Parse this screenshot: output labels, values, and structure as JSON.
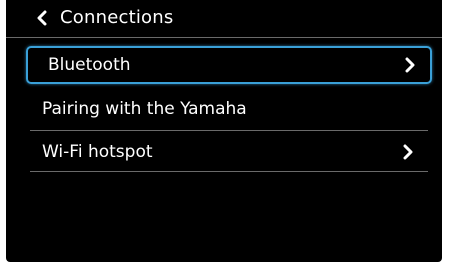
{
  "header": {
    "title": "Connections",
    "back_icon": "chevron-left-icon"
  },
  "menu": {
    "items": [
      {
        "label": "Bluetooth",
        "has_chevron": true,
        "selected": true
      },
      {
        "label": "Pairing with the Yamaha",
        "has_chevron": false,
        "selected": false
      },
      {
        "label": "Wi-Fi hotspot",
        "has_chevron": true,
        "selected": false
      }
    ]
  },
  "colors": {
    "background": "#000000",
    "text": "#ffffff",
    "selection_border": "#3aa0d8",
    "divider": "#6a6a6a"
  }
}
